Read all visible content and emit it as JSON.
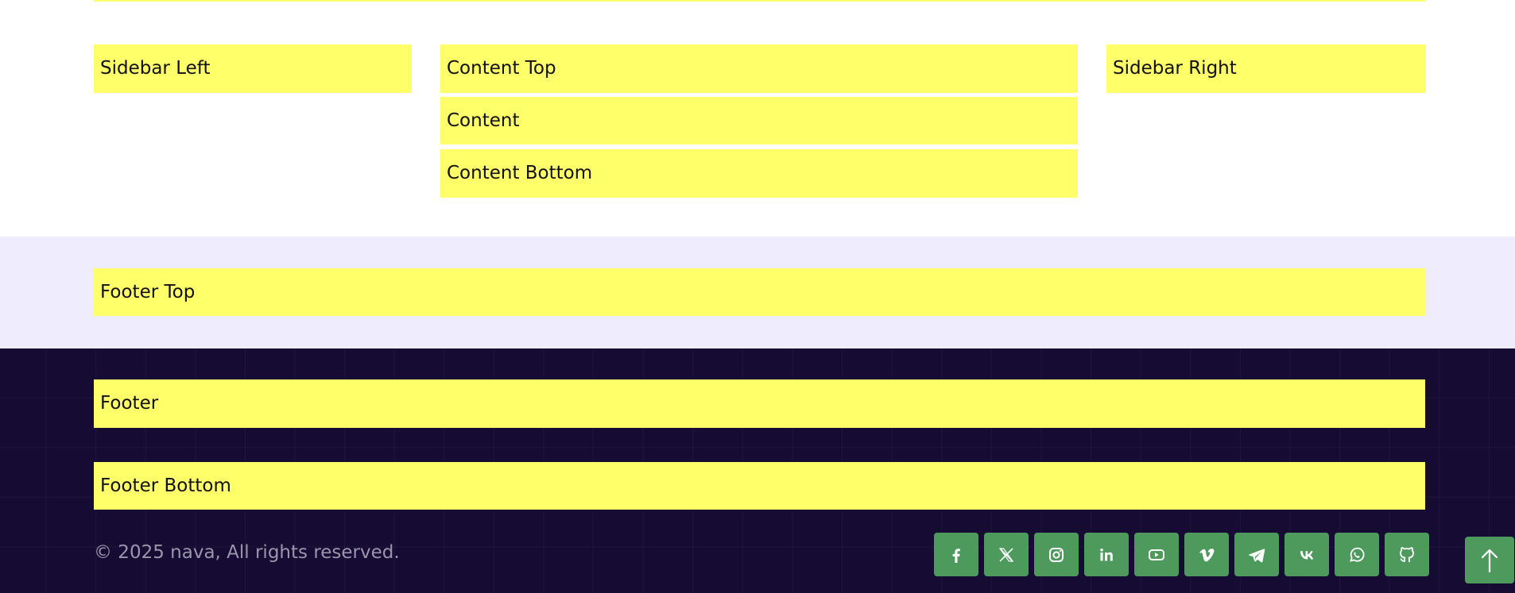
{
  "layout": {
    "sidebar_left": "Sidebar Left",
    "content_top": "Content Top",
    "content": "Content",
    "content_bottom": "Content Bottom",
    "sidebar_right": "Sidebar Right"
  },
  "footer": {
    "footer_top": "Footer Top",
    "footer": "Footer",
    "footer_bottom": "Footer Bottom",
    "copyright": "© 2025 nava, All rights reserved."
  },
  "social": [
    {
      "icon": "facebook-icon"
    },
    {
      "icon": "x-icon"
    },
    {
      "icon": "instagram-icon"
    },
    {
      "icon": "linkedin-icon"
    },
    {
      "icon": "youtube-icon"
    },
    {
      "icon": "vimeo-icon"
    },
    {
      "icon": "telegram-icon"
    },
    {
      "icon": "vk-icon"
    },
    {
      "icon": "whatsapp-icon"
    },
    {
      "icon": "github-icon"
    }
  ],
  "back_to_top": {
    "icon": "arrow-up-icon"
  },
  "colors": {
    "module_bg": "#ffff6a",
    "footer_top_bg": "#eeecfd",
    "footer_bg": "#150b33",
    "social_bg": "#4d9a5c",
    "copyright_text": "#9a96ac"
  }
}
